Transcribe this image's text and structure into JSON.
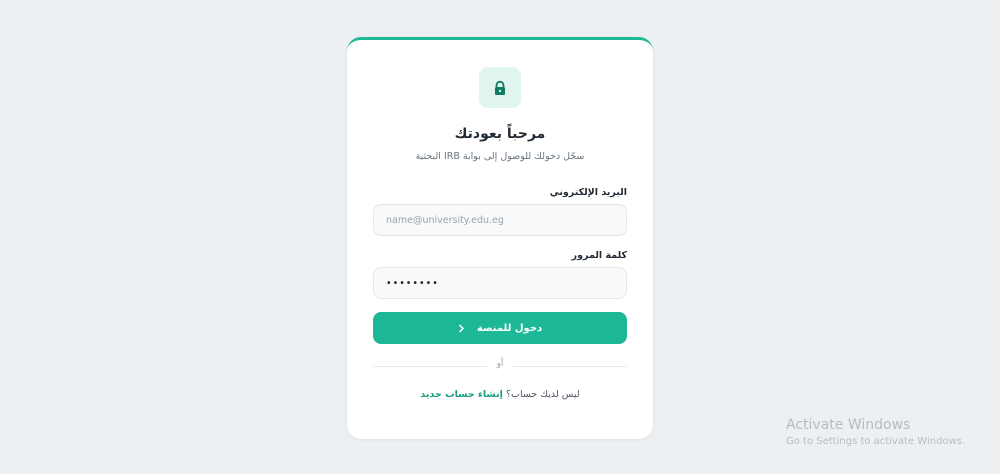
{
  "login": {
    "title": "مرحباً بعودتك",
    "subtitle": "سجّل دخولك للوصول إلى بوابة IRB البحثية",
    "email_label": "البريد الإلكتروني",
    "email_placeholder": "name@university.edu.eg",
    "email_value": "",
    "password_label": "كلمة المرور",
    "password_value": "••••••••",
    "submit_label": "دخول للمنصة",
    "submit_icon": "chevron-right-icon",
    "divider_text": "أو",
    "footer_text": "ليس لديك حساب؟",
    "signup_link": "إنشاء حساب جديد",
    "lock_icon": "lock-icon"
  },
  "colors": {
    "accent": "#1db898",
    "background": "#edf0f2",
    "card": "#ffffff"
  },
  "watermark": {
    "title": "Activate Windows",
    "subtitle": "Go to Settings to activate Windows."
  }
}
